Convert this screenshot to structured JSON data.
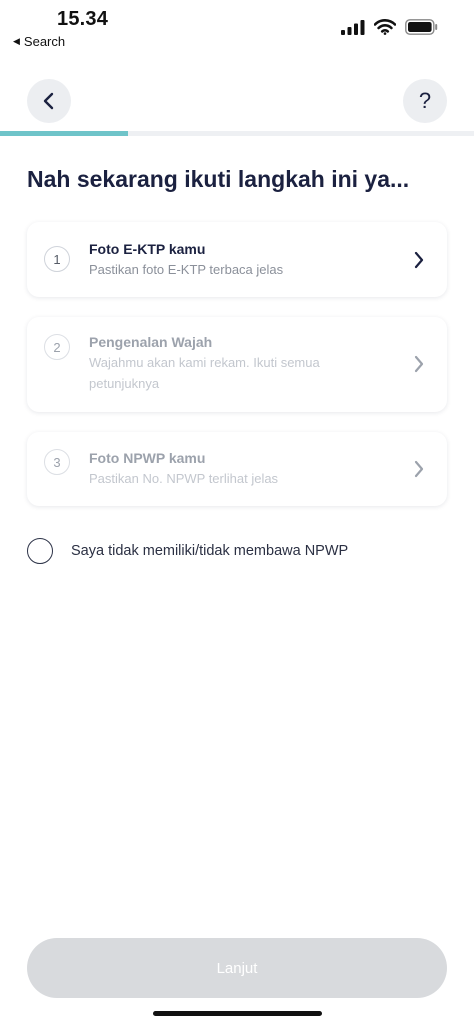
{
  "status_bar": {
    "time": "15.34",
    "back_label": "Search",
    "icons": [
      "cellular-signal-icon",
      "wifi-icon",
      "battery-icon"
    ]
  },
  "header": {
    "back_icon": "chevron-left-icon",
    "help_label": "?",
    "progress_fraction": 0.27,
    "accent_color": "#6fc4c9"
  },
  "page": {
    "title": "Nah sekarang ikuti langkah ini ya..."
  },
  "steps": [
    {
      "number": "1",
      "title": "Foto E-KTP kamu",
      "subtitle": "Pastikan foto E-KTP terbaca jelas",
      "state": "active"
    },
    {
      "number": "2",
      "title": "Pengenalan Wajah",
      "subtitle": "Wajahmu akan kami rekam. Ikuti semua petunjuknya",
      "state": "disabled"
    },
    {
      "number": "3",
      "title": "Foto NPWP kamu",
      "subtitle": "Pastikan No. NPWP terlihat jelas",
      "state": "disabled"
    }
  ],
  "no_npwp_option": {
    "label": "Saya tidak memiliki/tidak membawa NPWP",
    "checked": false
  },
  "footer": {
    "continue_label": "Lanjut",
    "continue_enabled": false,
    "disabled_color": "#d8dadd"
  }
}
